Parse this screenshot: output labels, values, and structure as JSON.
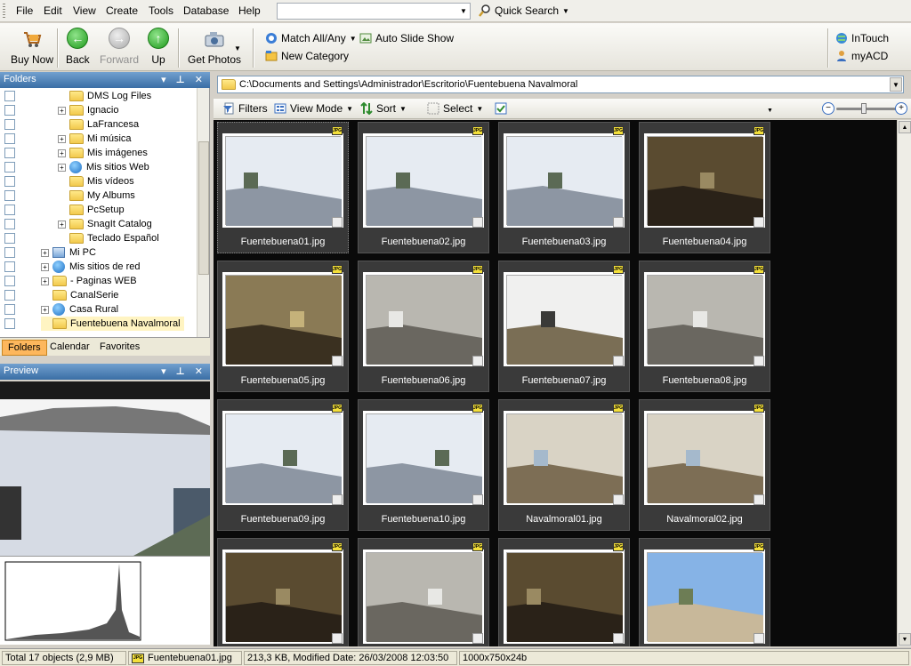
{
  "menu": {
    "items": [
      "File",
      "Edit",
      "View",
      "Create",
      "Tools",
      "Database",
      "Help"
    ],
    "quick_search": "Quick Search"
  },
  "toolbar": {
    "buy_now": "Buy Now",
    "back": "Back",
    "forward": "Forward",
    "up": "Up",
    "get_photos": "Get Photos",
    "match": "Match All/Any",
    "slide_show": "Auto Slide Show",
    "new_category": "New Category",
    "intouch": "InTouch",
    "myacd": "myACD"
  },
  "folders_pane": {
    "title": "Folders",
    "tree": [
      {
        "label": "DMS Log Files",
        "indent": 2,
        "expander": false,
        "icon": "folder"
      },
      {
        "label": "Ignacio",
        "indent": 2,
        "expander": true,
        "icon": "folder"
      },
      {
        "label": "LaFrancesa",
        "indent": 2,
        "expander": false,
        "icon": "folder"
      },
      {
        "label": "Mi música",
        "indent": 2,
        "expander": true,
        "icon": "folder"
      },
      {
        "label": "Mis imágenes",
        "indent": 2,
        "expander": true,
        "icon": "folder"
      },
      {
        "label": "Mis sitios Web",
        "indent": 2,
        "expander": true,
        "icon": "globe"
      },
      {
        "label": "Mis vídeos",
        "indent": 2,
        "expander": false,
        "icon": "folder"
      },
      {
        "label": "My Albums",
        "indent": 2,
        "expander": false,
        "icon": "folder"
      },
      {
        "label": "PcSetup",
        "indent": 2,
        "expander": false,
        "icon": "folder"
      },
      {
        "label": "SnagIt Catalog",
        "indent": 2,
        "expander": true,
        "icon": "folder"
      },
      {
        "label": "Teclado Español",
        "indent": 2,
        "expander": false,
        "icon": "folder"
      },
      {
        "label": "Mi PC",
        "indent": 1,
        "expander": true,
        "icon": "pc"
      },
      {
        "label": "Mis sitios de red",
        "indent": 1,
        "expander": true,
        "icon": "globe"
      },
      {
        "label": "- Paginas WEB",
        "indent": 1,
        "expander": true,
        "icon": "folder"
      },
      {
        "label": "CanalSerie",
        "indent": 1,
        "expander": false,
        "icon": "folder"
      },
      {
        "label": "Casa Rural",
        "indent": 1,
        "expander": true,
        "icon": "globe"
      },
      {
        "label": "Fuentebuena Navalmoral",
        "indent": 1,
        "expander": false,
        "icon": "folder",
        "selected": true
      }
    ],
    "tabs": [
      "Folders",
      "Calendar",
      "Favorites"
    ]
  },
  "preview_pane": {
    "title": "Preview"
  },
  "path": "C:\\Documents and Settings\\Administrador\\Escritorio\\Fuentebuena Navalmoral",
  "viewbar": {
    "filters": "Filters",
    "view_mode": "View Mode",
    "sort": "Sort",
    "select": "Select"
  },
  "file_badge": "JPG",
  "thumbnails": [
    {
      "name": "Fuentebuena01.jpg",
      "tone": "wall"
    },
    {
      "name": "Fuentebuena02.jpg",
      "tone": "wall"
    },
    {
      "name": "Fuentebuena03.jpg",
      "tone": "wall"
    },
    {
      "name": "Fuentebuena04.jpg",
      "tone": "dark-interior"
    },
    {
      "name": "Fuentebuena05.jpg",
      "tone": "rock"
    },
    {
      "name": "Fuentebuena06.jpg",
      "tone": "gray-interior"
    },
    {
      "name": "Fuentebuena07.jpg",
      "tone": "white-interior"
    },
    {
      "name": "Fuentebuena08.jpg",
      "tone": "gray-interior"
    },
    {
      "name": "Fuentebuena09.jpg",
      "tone": "wall"
    },
    {
      "name": "Fuentebuena10.jpg",
      "tone": "wall"
    },
    {
      "name": "Navalmoral01.jpg",
      "tone": "house"
    },
    {
      "name": "Navalmoral02.jpg",
      "tone": "house"
    },
    {
      "name": "",
      "tone": "dark-interior"
    },
    {
      "name": "",
      "tone": "gray-interior"
    },
    {
      "name": "",
      "tone": "dark-interior"
    },
    {
      "name": "",
      "tone": "sky-house"
    }
  ],
  "status": {
    "total": "Total 17 objects  (2,9 MB)",
    "file": "Fuentebuena01.jpg",
    "info": "213,3 KB, Modified Date: 26/03/2008 12:03:50",
    "dims": "1000x750x24b"
  }
}
